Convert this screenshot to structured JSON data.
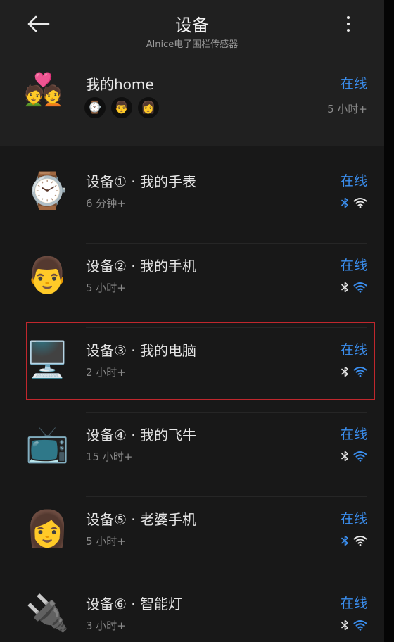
{
  "header": {
    "title": "设备",
    "subtitle": "Alnice电子围栏传感器",
    "back_icon": "arrow-left-icon",
    "more_icon": "more-vertical-icon"
  },
  "home": {
    "emoji": "💑",
    "name": "我的home",
    "avatars": [
      "⌚",
      "👨",
      "👩"
    ],
    "status": "在线",
    "time": "5 小时+"
  },
  "colors": {
    "accent": "#3b8ff0",
    "online": "#3b8ff0",
    "icon_inactive": "#e6e6e6",
    "highlight_border": "#c0272d"
  },
  "devices": [
    {
      "emoji": "⌚",
      "name": "设备① · 我的手表",
      "time": "6 分钟+",
      "status": "在线",
      "bt_active": true,
      "wifi_active": false
    },
    {
      "emoji": "👨",
      "name": "设备② · 我的手机",
      "time": "5 小时+",
      "status": "在线",
      "bt_active": false,
      "wifi_active": true
    },
    {
      "emoji": "🖥️",
      "name": "设备③ · 我的电脑",
      "time": "2 小时+",
      "status": "在线",
      "bt_active": false,
      "wifi_active": true
    },
    {
      "emoji": "📺",
      "name": "设备④ · 我的飞牛",
      "time": "15 小时+",
      "status": "在线",
      "bt_active": false,
      "wifi_active": true
    },
    {
      "emoji": "👩",
      "name": "设备⑤ · 老婆手机",
      "time": "5 小时+",
      "status": "在线",
      "bt_active": true,
      "wifi_active": false
    },
    {
      "emoji": "🔌",
      "name": "设备⑥ · 智能灯",
      "time": "3 小时+",
      "status": "在线",
      "bt_active": false,
      "wifi_active": true
    }
  ]
}
